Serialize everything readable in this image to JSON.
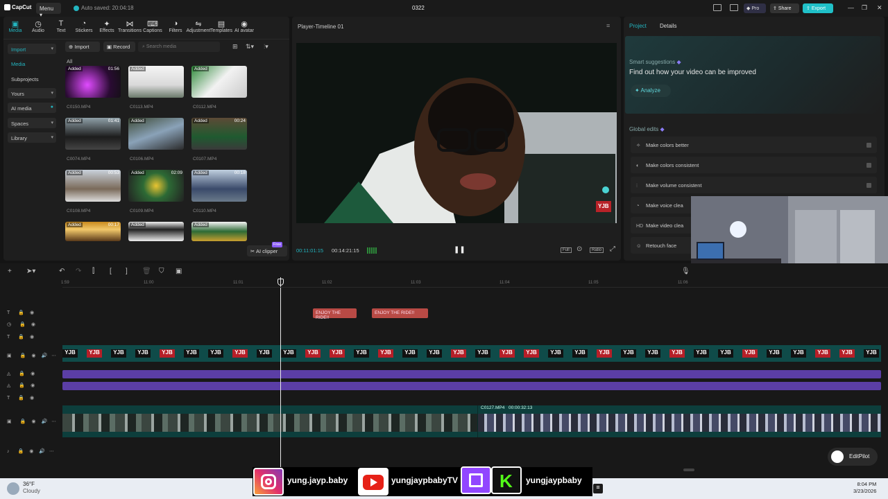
{
  "app": {
    "logo": "CapCut",
    "menu_label": "Menu",
    "autosave": "Auto saved: 20:04:18",
    "project_title": "0322",
    "pro_label": "Pro",
    "share_label": "Share",
    "export_label": "Export",
    "accent_color": "#23b5c0"
  },
  "toolbar": {
    "items": [
      {
        "label": "Media",
        "icon": "media-icon"
      },
      {
        "label": "Audio",
        "icon": "audio-icon"
      },
      {
        "label": "Text",
        "icon": "text-icon"
      },
      {
        "label": "Stickers",
        "icon": "stickers-icon"
      },
      {
        "label": "Effects",
        "icon": "effects-icon"
      },
      {
        "label": "Transitions",
        "icon": "transitions-icon"
      },
      {
        "label": "Captions",
        "icon": "captions-icon"
      },
      {
        "label": "Filters",
        "icon": "filters-icon"
      },
      {
        "label": "Adjustment",
        "icon": "adjustment-icon"
      },
      {
        "label": "Templates",
        "icon": "templates-icon"
      },
      {
        "label": "AI avatar",
        "icon": "ai-avatar-icon"
      }
    ]
  },
  "sidebar": {
    "items": [
      "Import",
      "Media",
      "Subprojects",
      "Yours",
      "AI media",
      "Spaces",
      "Library"
    ]
  },
  "media": {
    "import_label": "Import",
    "record_label": "Record",
    "search_placeholder": "Search media",
    "filter_label": "All",
    "added_tag": "Added",
    "clipper_label": "AI clipper",
    "free_badge": "Free",
    "items": [
      {
        "name": "C0150.MP4",
        "duration": "01:56"
      },
      {
        "name": "C0113.MP4",
        "duration": ""
      },
      {
        "name": "C0112.MP4",
        "duration": ""
      },
      {
        "name": "C0074.MP4",
        "duration": "01:41"
      },
      {
        "name": "C0106.MP4",
        "duration": ""
      },
      {
        "name": "C0107.MP4",
        "duration": "00:24"
      },
      {
        "name": "C0108.MP4",
        "duration": "00:53"
      },
      {
        "name": "C0109.MP4",
        "duration": "02:09"
      },
      {
        "name": "C0110.MP4",
        "duration": "00:18"
      },
      {
        "name": "",
        "duration": "00:17"
      },
      {
        "name": "",
        "duration": ""
      },
      {
        "name": "",
        "duration": ""
      }
    ]
  },
  "player": {
    "title": "Player-Timeline 01",
    "current_time": "00:11:01:15",
    "total_time": "00:14:21:15",
    "watermark": "YJB",
    "full_label": "Full",
    "ratio_label": "Ratio"
  },
  "right_panel": {
    "tabs": [
      "Project",
      "Details"
    ],
    "smart_label": "Smart suggestions",
    "smart_title": "Find out how your video can be improved",
    "analyze_label": "Analyze",
    "global_label": "Global edits",
    "edits": [
      {
        "label": "Make colors better",
        "icon": "wand-icon"
      },
      {
        "label": "Make colors consistent",
        "icon": "palette-icon"
      },
      {
        "label": "Make volume consistent",
        "icon": "sliders-icon"
      },
      {
        "label": "Make voice clea",
        "icon": "voice-icon"
      },
      {
        "label": "Make video clea",
        "icon": "hd-icon"
      },
      {
        "label": "Retouch face",
        "icon": "face-icon"
      }
    ]
  },
  "timeline": {
    "ruler": [
      "1:59",
      "11:00",
      "11:01",
      "11:02",
      "11:03",
      "11:04",
      "11:05",
      "11:06"
    ],
    "captions": [
      "ENJOY THE RIDE!!",
      "ENJOY THE RIDE!!"
    ],
    "logo_text": "YJB",
    "clip_name": "C0127.MP4",
    "clip_duration": "00:00:32:13",
    "editpilot_label": "EditPilot"
  },
  "overlay": {
    "instagram": "yung.jayp.baby",
    "youtube": "yungjaypbabyTV",
    "kick": "yungjaypbaby"
  },
  "taskbar": {
    "temp": "36°F",
    "weather": "Cloudy",
    "time": "8:04 PM",
    "date": "3/23/2026"
  }
}
